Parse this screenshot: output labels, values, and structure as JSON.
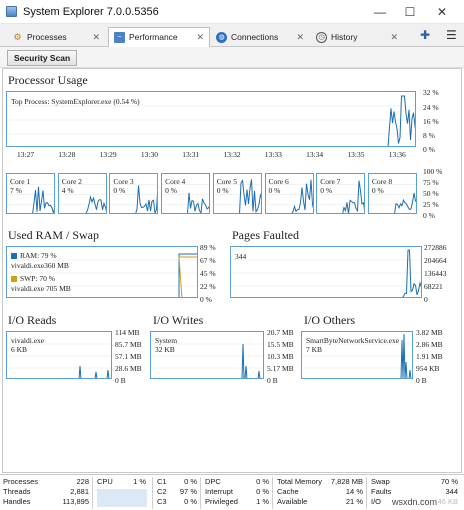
{
  "window": {
    "title": "System Explorer 7.0.0.5356",
    "minimize_glyph": "—",
    "maximize_glyph": "☐",
    "close_glyph": "✕"
  },
  "tabs": [
    {
      "label": "Processes",
      "icon": "processes-gear-icon",
      "active": false
    },
    {
      "label": "Performance",
      "icon": "performance-monitor-icon",
      "active": true
    },
    {
      "label": "Connections",
      "icon": "globe-icon",
      "active": false
    },
    {
      "label": "History",
      "icon": "clock-icon",
      "active": false
    }
  ],
  "tab_close_glyph": "✕",
  "tabbar_icons": {
    "add": "✚",
    "menu": "☰"
  },
  "toolbar": {
    "scan_label": "Security Scan"
  },
  "processor": {
    "title": "Processor Usage",
    "top_process": "Top Process: SystemExplorer.exe (0.54 %)",
    "y_ticks": [
      "32 %",
      "24 %",
      "16 %",
      "8 %",
      "0 %"
    ],
    "x_ticks": [
      "13:27",
      "13:28",
      "13:29",
      "13:30",
      "13:31",
      "13:32",
      "13:33",
      "13:34",
      "13:35",
      "13:36"
    ]
  },
  "cores": {
    "y_ticks": [
      "100 %",
      "75 %",
      "50 %",
      "25 %",
      "0 %"
    ],
    "items": [
      {
        "name": "Core 1",
        "value": "7 %"
      },
      {
        "name": "Core 2",
        "value": "4 %"
      },
      {
        "name": "Core 3",
        "value": "0 %"
      },
      {
        "name": "Core 4",
        "value": "0 %"
      },
      {
        "name": "Core 5",
        "value": "0 %"
      },
      {
        "name": "Core 6",
        "value": "0 %"
      },
      {
        "name": "Core 7",
        "value": "0 %"
      },
      {
        "name": "Core 8",
        "value": "0 %"
      }
    ]
  },
  "ram": {
    "title": "Used RAM / Swap",
    "ram_label": "RAM: 79 %",
    "ram_proc": "vivaldi.exe360 MB",
    "swp_label": "SWP: 70 %",
    "swp_proc": "vivaldi.exe 705 MB",
    "ram_color": "#1f6fb2",
    "swp_color": "#c8a216",
    "y_ticks": [
      "89 %",
      "67 %",
      "45 %",
      "22 %",
      "0 %"
    ]
  },
  "pages": {
    "title": "Pages Faulted",
    "value": "344",
    "y_ticks": [
      "272886",
      "204664",
      "136443",
      "68221",
      "0"
    ]
  },
  "io_reads": {
    "title": "I/O Reads",
    "proc": "vivaldi.exe",
    "value": "6 KB",
    "y_ticks": [
      "114 MB",
      "85.7 MB",
      "57.1 MB",
      "28.6 MB",
      "0 B"
    ]
  },
  "io_writes": {
    "title": "I/O Writes",
    "proc": "System",
    "value": "32 KB",
    "y_ticks": [
      "20.7 MB",
      "15.5 MB",
      "10.3 MB",
      "5.17 MB",
      "0 B"
    ]
  },
  "io_others": {
    "title": "I/O Others",
    "proc": "SmartByteNetworkService.exe",
    "value": "7 KB",
    "y_ticks": [
      "3.82 MB",
      "2.86 MB",
      "1.91 MB",
      "954 KB",
      "0 B"
    ]
  },
  "statusbar": {
    "processes_label": "Processes",
    "processes_value": "228",
    "threads_label": "Threads",
    "threads_value": "2,881",
    "handles_label": "Handles",
    "handles_value": "113,895",
    "cpu_label": "CPU",
    "cpu_value": "1 %",
    "c1_label": "C1",
    "c1_value": "0 %",
    "c2_label": "C2",
    "c2_value": "97 %",
    "c3_label": "C3",
    "c3_value": "0 %",
    "dpc_label": "DPC",
    "dpc_value": "0 %",
    "interrupt_label": "Interrupt",
    "interrupt_value": "0 %",
    "privileged_label": "Privileged",
    "privileged_value": "1 %",
    "total_memory_label": "Total Memory",
    "total_memory_value": "7,828 MB",
    "cache_label": "Cache",
    "cache_value": "14 %",
    "available_label": "Available",
    "available_value": "21 %",
    "swap_label": "Swap",
    "swap_value": "70 %",
    "faults_label": "Faults",
    "faults_value": "344",
    "io_label": "I/O",
    "io_value": "46 KB"
  },
  "watermark": "wsxdn.com",
  "colors": {
    "chart_line": "#1a6fb0",
    "chart_border": "#5aa0d0",
    "grid": "#e4e4e4"
  }
}
